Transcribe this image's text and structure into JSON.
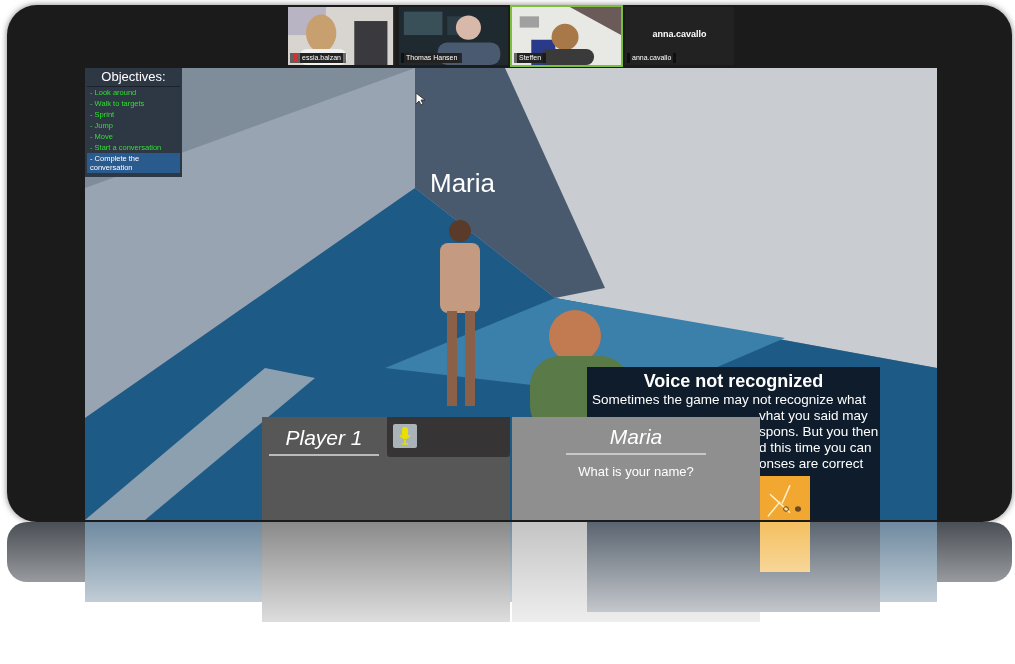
{
  "meeting": {
    "participants": [
      {
        "name": "essia.balzan",
        "muted": true,
        "speaking": false
      },
      {
        "name": "Thomas Hansen",
        "muted": false,
        "speaking": false
      },
      {
        "name": "Steffen",
        "muted": false,
        "speaking": true
      },
      {
        "name": "anna.cavallo",
        "display_name": "anna.cavallo",
        "muted": false,
        "speaking": false
      }
    ]
  },
  "game": {
    "objectives": {
      "title": "Objectives:",
      "items": [
        {
          "text": "- Look around",
          "done": true,
          "selected": false
        },
        {
          "text": "- Walk to targets",
          "done": true,
          "selected": false
        },
        {
          "text": "- Sprint",
          "done": true,
          "selected": false
        },
        {
          "text": "- Jump",
          "done": true,
          "selected": false
        },
        {
          "text": "- Move",
          "done": true,
          "selected": false
        },
        {
          "text": "- Start a conversation",
          "done": true,
          "selected": false
        },
        {
          "text": "- Complete the conversation",
          "done": false,
          "selected": true
        }
      ]
    },
    "npc_name": "Maria",
    "voice_notice": {
      "title": "Voice not recognized",
      "lines": [
        "Sometimes the game may not recognize what",
        "vhat you said may",
        "spons. But you then",
        "d this time you can",
        "onses are correct"
      ]
    },
    "player_panel": {
      "name": "Player 1"
    },
    "npc_panel": {
      "name": "Maria",
      "line": "What is your name?"
    }
  }
}
